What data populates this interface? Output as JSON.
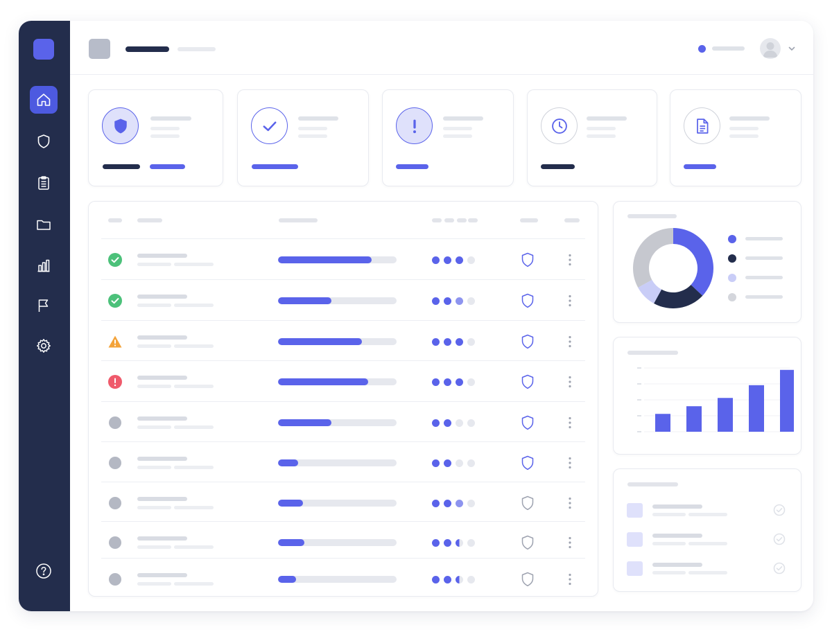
{
  "colors": {
    "sidebar": "#232d4c",
    "accent": "#5a63ea",
    "navy": "#232d4c",
    "success": "#4cc17a",
    "warning": "#f3a33a",
    "danger": "#ef5a6b",
    "neutral": "#b4b8c3",
    "track": "#e6e8ee",
    "placeholder": "#dfe2e8"
  },
  "sidebar": {
    "items": [
      {
        "name": "home",
        "icon": "home-icon",
        "active": true
      },
      {
        "name": "security",
        "icon": "shield-icon",
        "active": false
      },
      {
        "name": "reports",
        "icon": "clipboard-icon",
        "active": false
      },
      {
        "name": "files",
        "icon": "folder-icon",
        "active": false
      },
      {
        "name": "analytics",
        "icon": "bar-chart-icon",
        "active": false
      },
      {
        "name": "flags",
        "icon": "flag-icon",
        "active": false
      },
      {
        "name": "settings",
        "icon": "gear-icon",
        "active": false
      }
    ],
    "help_icon": "help-icon"
  },
  "header": {
    "title": "",
    "subtitle": "",
    "status": "online",
    "user_avatar": "avatar-icon"
  },
  "stat_cards": [
    {
      "icon": "shield-icon",
      "style": "filled",
      "bars": [
        "navy",
        "accent"
      ]
    },
    {
      "icon": "check-icon",
      "style": "outline",
      "bars": [
        "accent"
      ]
    },
    {
      "icon": "exclamation-icon",
      "style": "filled",
      "bars": [
        "accent"
      ]
    },
    {
      "icon": "clock-icon",
      "style": "outline",
      "bars": [
        "navy"
      ]
    },
    {
      "icon": "document-icon",
      "style": "outline",
      "bars": [
        "accent"
      ]
    }
  ],
  "table": {
    "rows": [
      {
        "status": "success",
        "progress": 0.79,
        "dots": [
          "full",
          "full",
          "full",
          "empty"
        ],
        "shield": "accent"
      },
      {
        "status": "success",
        "progress": 0.45,
        "dots": [
          "full",
          "full",
          "light",
          "empty"
        ],
        "shield": "accent"
      },
      {
        "status": "warning",
        "progress": 0.71,
        "dots": [
          "full",
          "full",
          "full",
          "empty"
        ],
        "shield": "accent"
      },
      {
        "status": "danger",
        "progress": 0.76,
        "dots": [
          "full",
          "full",
          "full",
          "empty"
        ],
        "shield": "accent"
      },
      {
        "status": "neutral",
        "progress": 0.45,
        "dots": [
          "full",
          "full",
          "empty",
          "empty"
        ],
        "shield": "accent"
      },
      {
        "status": "neutral",
        "progress": 0.17,
        "dots": [
          "full",
          "full",
          "empty",
          "empty"
        ],
        "shield": "accent"
      },
      {
        "status": "neutral",
        "progress": 0.21,
        "dots": [
          "full",
          "full",
          "light",
          "empty"
        ],
        "shield": "gray"
      },
      {
        "status": "neutral",
        "progress": 0.22,
        "dots": [
          "full",
          "full",
          "half",
          "empty"
        ],
        "shield": "gray"
      },
      {
        "status": "neutral",
        "progress": 0.15,
        "dots": [
          "full",
          "full",
          "half",
          "empty"
        ],
        "shield": "gray"
      }
    ]
  },
  "chart_data": [
    {
      "type": "pie",
      "values": [
        0.37,
        0.21,
        0.09,
        0.33
      ],
      "colors": [
        "#5a63ea",
        "#232d4c",
        "#c9cdf7",
        "#c6c8cf"
      ]
    },
    {
      "type": "bar",
      "values": [
        28,
        40,
        53,
        73,
        97
      ],
      "ylim": [
        0,
        100
      ],
      "color": "#5a63ea"
    }
  ],
  "checklist": {
    "items": [
      {
        "done": true
      },
      {
        "done": true
      },
      {
        "done": true
      }
    ]
  }
}
